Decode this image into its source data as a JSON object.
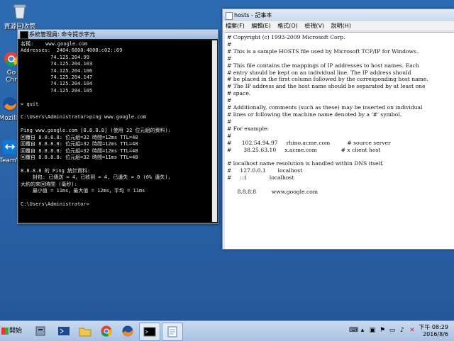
{
  "desktop": {
    "icons": [
      {
        "label": "資源回收筒",
        "icon": "recycle-bin-icon"
      },
      {
        "label": "Go\nChr",
        "icon": "chrome-icon"
      },
      {
        "label": "Mozilla",
        "icon": "firefox-icon"
      },
      {
        "label": "TeamV",
        "icon": "teamviewer-icon"
      }
    ]
  },
  "cmd": {
    "title": "系統管理員: 命令提示字元",
    "lines": [
      "名稱:    www.google.com",
      "Addresses:  2404:6800:4008:c02::69",
      "          74.125.204.99",
      "          74.125.204.103",
      "          74.125.204.106",
      "          74.125.204.147",
      "          74.125.204.104",
      "          74.125.204.105",
      "",
      "> quit",
      "",
      "C:\\Users\\Administrator>ping www.google.com",
      "",
      "Ping www.google.com [8.8.8.8] (使用 32 位元組的資料):",
      "回覆自 8.8.8.8: 位元組=32 時間=12ms TTL=48",
      "回覆自 8.8.8.8: 位元組=32 時間=12ms TTL=48",
      "回覆自 8.8.8.8: 位元組=32 時間=12ms TTL=48",
      "回覆自 8.8.8.8: 位元組=32 時間=11ms TTL=48",
      "",
      "8.8.8.8 的 Ping 統計資料:",
      "    封包: 已傳送 = 4，已收到 = 4, 已遺失 = 0 (0% 遺失)，",
      "大約的來回時間 (毫秒):",
      "    最小值 = 11ms，最大值 = 12ms，平均 = 11ms",
      "",
      "C:\\Users\\Administrator>"
    ]
  },
  "notepad": {
    "title": "hosts - 記事本",
    "menu": [
      "檔案(F)",
      "編輯(E)",
      "格式(O)",
      "檢視(V)",
      "說明(H)"
    ],
    "lines": [
      "# Copyright (c) 1993-2009 Microsoft Corp.",
      "#",
      "# This is a sample HOSTS file used by Microsoft TCP/IP for Windows.",
      "#",
      "# This file contains the mappings of IP addresses to host names. Each",
      "# entry should be kept on an individual line. The IP address should",
      "# be placed in the first column followed by the corresponding host name.",
      "# The IP address and the host name should be separated by at least one",
      "# space.",
      "#",
      "# Additionally, comments (such as these) may be inserted on individual",
      "# lines or following the machine name denoted by a '#' symbol.",
      "#",
      "# For example:",
      "#",
      "#      102.54.94.97     rhino.acme.com          # source server",
      "#       38.25.63.10     x.acme.com              # x client host",
      "",
      "# localhost name resolution is handled within DNS itself.",
      "#     127.0.0.1       localhost",
      "#     ::1             localhost",
      "",
      "      8.8.8.8         www.google.com"
    ]
  },
  "taskbar": {
    "start_label": "開始",
    "buttons": [
      "server-manager-icon",
      "powershell-icon",
      "explorer-folder-icon",
      "chrome-icon",
      "firefox-icon",
      "cmd-icon",
      "notepad-icon"
    ],
    "clock_time": "下午 08:29",
    "clock_date": "2016/8/6"
  }
}
